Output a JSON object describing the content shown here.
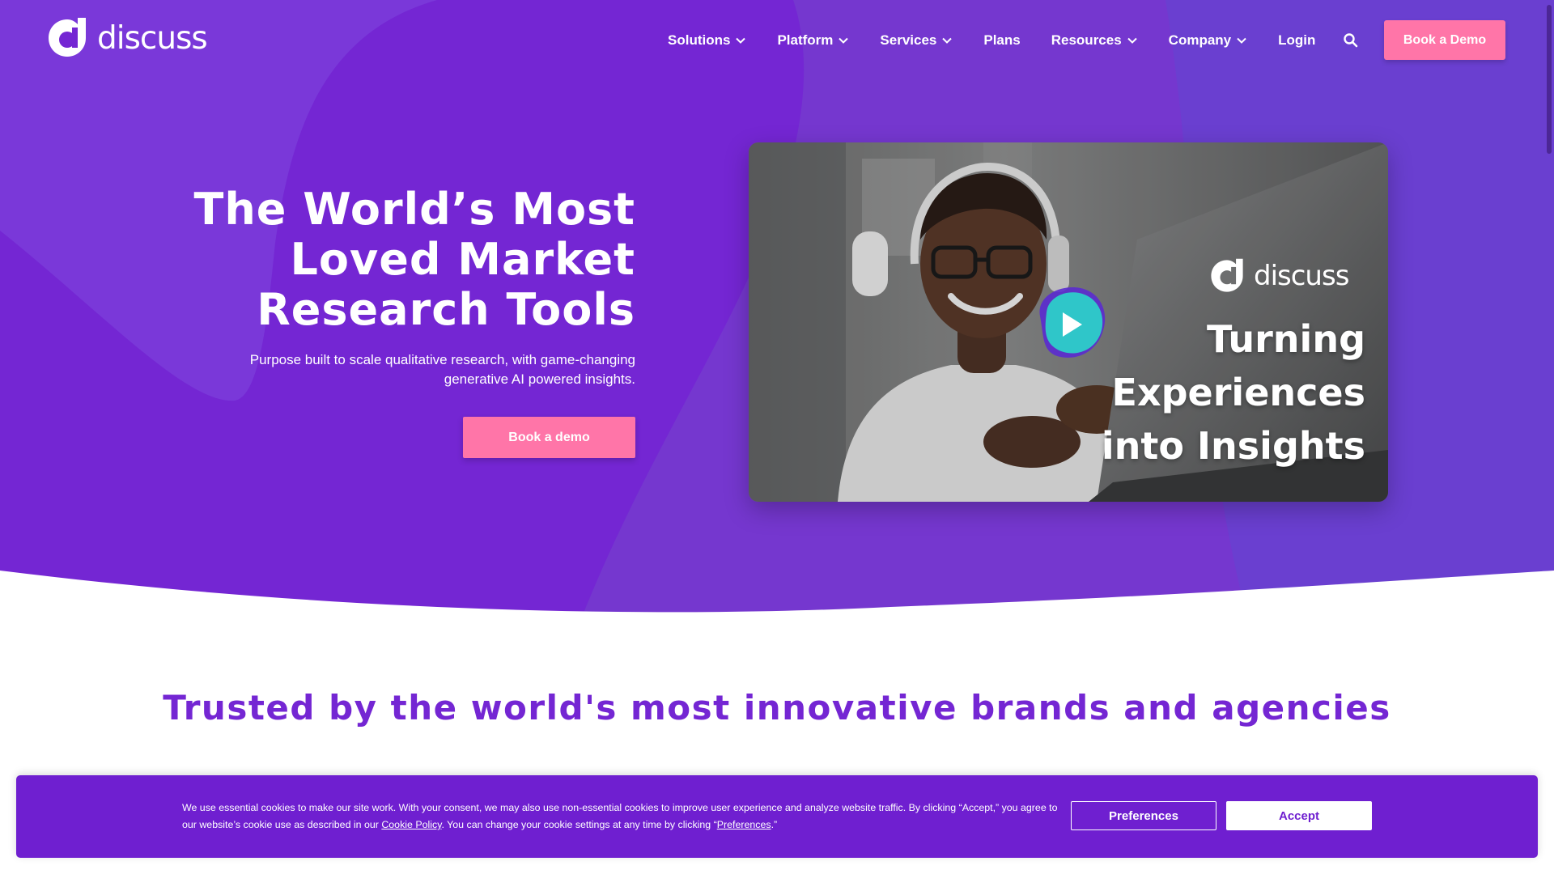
{
  "brand": {
    "name": "discuss"
  },
  "nav": {
    "items": [
      {
        "label": "Solutions",
        "dropdown": true
      },
      {
        "label": "Platform",
        "dropdown": true
      },
      {
        "label": "Services",
        "dropdown": true
      },
      {
        "label": "Plans",
        "dropdown": false
      },
      {
        "label": "Resources",
        "dropdown": true
      },
      {
        "label": "Company",
        "dropdown": true
      },
      {
        "label": "Login",
        "dropdown": false
      }
    ],
    "search_icon": "search-icon",
    "cta_label": "Book a Demo"
  },
  "hero": {
    "title_lines": [
      "The World’s Most",
      "Loved Market",
      "Research Tools"
    ],
    "subtitle_lines": [
      "Purpose built to scale qualitative research, with game-changing",
      "generative AI powered insights."
    ],
    "cta_label": "Book a demo",
    "video": {
      "brand": "discuss",
      "caption_lines": [
        "Turning",
        "Experiences",
        "into Insights"
      ],
      "play_icon": "play-icon"
    }
  },
  "trusted": {
    "heading": "Trusted by the world's most innovative brands and agencies"
  },
  "cookie": {
    "text_part1": "We use essential cookies to make our site work. With your consent, we may also use non-essential cookies to improve user experience and analyze website traffic. By clicking “Accept,” you agree to our website’s cookie use as described in our ",
    "cookie_policy_link": "Cookie Policy",
    "text_part2": ". You can change your cookie settings at any time by clicking “",
    "preferences_link": "Preferences",
    "text_part3": ".”",
    "preferences_label": "Preferences",
    "accept_label": "Accept"
  },
  "colors": {
    "brand_purple": "#7426d3",
    "accent_pink": "#ff75a8",
    "cookie_bg": "#6f1fd0",
    "play_teal": "#2fc6c9"
  }
}
